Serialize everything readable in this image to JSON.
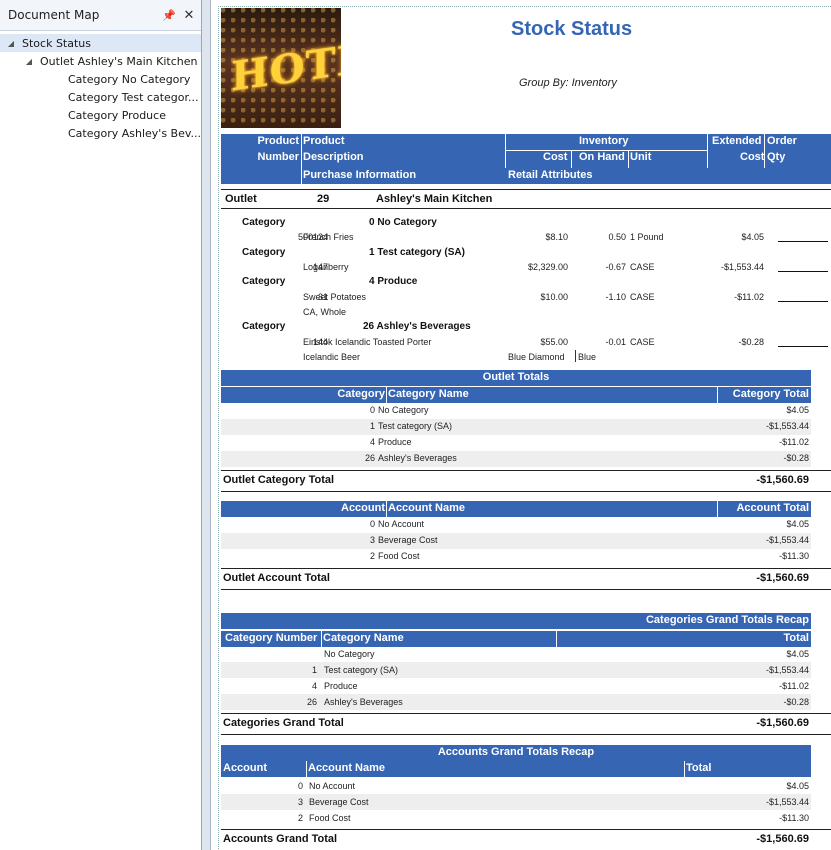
{
  "doc_map": {
    "title": "Document Map",
    "items": [
      {
        "label": "Stock Status"
      },
      {
        "label": "Outlet Ashley's Main Kitchen"
      },
      {
        "label": "Category No Category"
      },
      {
        "label": "Category Test categor..."
      },
      {
        "label": "Category Produce"
      },
      {
        "label": "Category Ashley's Bev..."
      }
    ]
  },
  "report": {
    "logo_text": "HOTEL",
    "title": "Stock Status",
    "group_by": "Group By: Inventory",
    "header": {
      "product": "Product",
      "number": "Number",
      "product2": "Product",
      "description": "Description",
      "purchase_info": "Purchase Information",
      "inventory": "Inventory",
      "cost": "Cost",
      "on_hand": "On Hand",
      "unit": "Unit",
      "retail_attributes": "Retail Attributes",
      "extended": "Extended",
      "extended_cost": "Cost",
      "order": "Order",
      "qty": "Qty"
    },
    "outlet": {
      "label": "Outlet",
      "number": "29",
      "name": "Ashley's Main Kitchen"
    },
    "categories": [
      {
        "label": "Category",
        "title": "0 No Category",
        "items": [
          {
            "number": "500124",
            "description": "French Fries",
            "sub": "",
            "cost": "$8.10",
            "on_hand": "0.50",
            "unit": "1 Pound",
            "extended": "$4.05",
            "retail": "",
            "retail2": ""
          }
        ]
      },
      {
        "label": "Category",
        "title": "1 Test category (SA)",
        "items": [
          {
            "number": "147",
            "description": "Loganberry",
            "sub": "",
            "cost": "$2,329.00",
            "on_hand": "-0.67",
            "unit": "CASE",
            "extended": "-$1,553.44",
            "retail": "",
            "retail2": ""
          }
        ]
      },
      {
        "label": "Category",
        "title": "4 Produce",
        "items": [
          {
            "number": "31",
            "description": "Sweet Potatoes",
            "sub": "CA, Whole",
            "cost": "$10.00",
            "on_hand": "-1.10",
            "unit": "CASE",
            "extended": "-$11.02",
            "retail": "",
            "retail2": ""
          }
        ]
      },
      {
        "label": "Category",
        "title": "26 Ashley's Beverages",
        "items": [
          {
            "number": "144",
            "description": "Einstök Icelandic Toasted Porter",
            "sub": "Icelandic Beer",
            "cost": "$55.00",
            "on_hand": "-0.01",
            "unit": "CASE",
            "extended": "-$0.28",
            "retail": "Blue Diamond",
            "retail2": "Blue"
          }
        ]
      }
    ],
    "outlet_totals": {
      "title": "Outlet Totals",
      "col_category": "Category",
      "col_name": "Category Name",
      "col_total": "Category Total",
      "rows": [
        {
          "num": "0",
          "name": "No Category",
          "total": "$4.05"
        },
        {
          "num": "1",
          "name": "Test category (SA)",
          "total": "-$1,553.44"
        },
        {
          "num": "4",
          "name": "Produce",
          "total": "-$11.02"
        },
        {
          "num": "26",
          "name": "Ashley's Beverages",
          "total": "-$0.28"
        }
      ],
      "total_label": "Outlet Category Total",
      "total_value": "-$1,560.69"
    },
    "outlet_accounts": {
      "col_account": "Account",
      "col_name": "Account Name",
      "col_total": "Account Total",
      "rows": [
        {
          "num": "0",
          "name": "No Account",
          "total": "$4.05"
        },
        {
          "num": "3",
          "name": "Beverage Cost",
          "total": "-$1,553.44"
        },
        {
          "num": "2",
          "name": "Food Cost",
          "total": "-$11.30"
        }
      ],
      "total_label": "Outlet Account Total",
      "total_value": "-$1,560.69"
    },
    "cat_recap": {
      "title": "Categories Grand Totals Recap",
      "col_number": "Category Number",
      "col_name": "Category Name",
      "col_total": "Total",
      "rows": [
        {
          "num": "",
          "name": "No Category",
          "total": "$4.05"
        },
        {
          "num": "1",
          "name": "Test category (SA)",
          "total": "-$1,553.44"
        },
        {
          "num": "4",
          "name": "Produce",
          "total": "-$11.02"
        },
        {
          "num": "26",
          "name": "Ashley's Beverages",
          "total": "-$0.28"
        }
      ],
      "total_label": "Categories Grand Total",
      "total_value": "-$1,560.69"
    },
    "acct_recap": {
      "title": "Accounts Grand Totals Recap",
      "col_account": "Account",
      "col_name": "Account Name",
      "col_total": "Total",
      "rows": [
        {
          "num": "0",
          "name": "No Account",
          "total": "$4.05"
        },
        {
          "num": "3",
          "name": "Beverage Cost",
          "total": "-$1,553.44"
        },
        {
          "num": "2",
          "name": "Food Cost",
          "total": "-$11.30"
        }
      ],
      "total_label": "Accounts Grand Total",
      "total_value": "-$1,560.69"
    }
  }
}
